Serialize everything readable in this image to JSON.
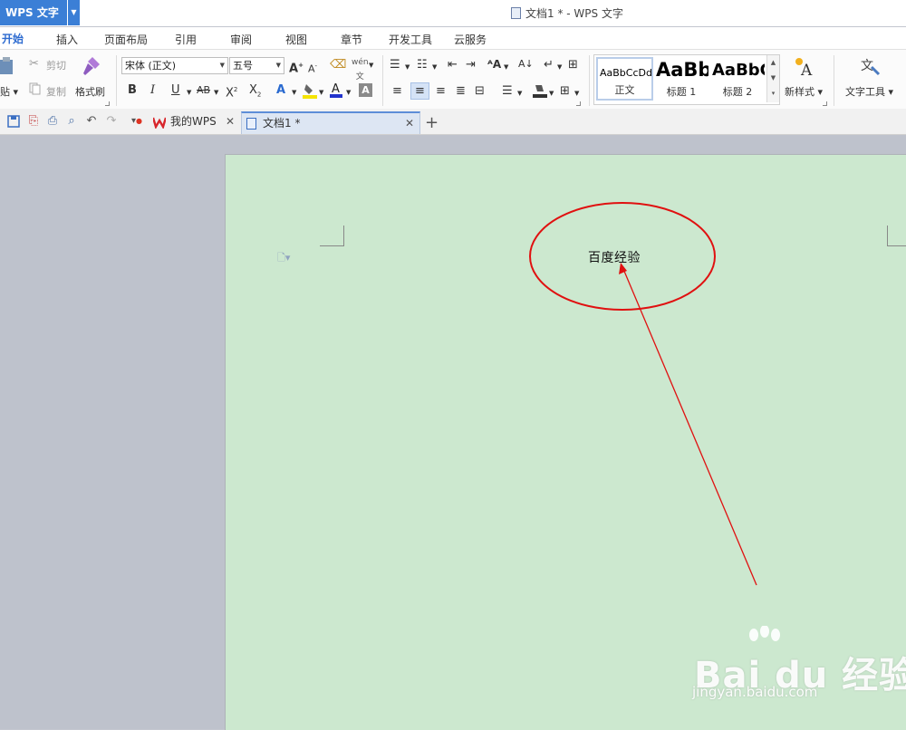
{
  "app": {
    "name": "WPS 文字",
    "window_title": "文档1 * - WPS 文字"
  },
  "menu": {
    "tabs": [
      "开始",
      "插入",
      "页面布局",
      "引用",
      "审阅",
      "视图",
      "章节",
      "开发工具",
      "云服务"
    ]
  },
  "ribbon": {
    "clipboard": {
      "paste": "贴",
      "cut": "剪切",
      "copy": "复制",
      "format_painter": "格式刷"
    },
    "font": {
      "family": "宋体 (正文)",
      "size": "五号"
    },
    "styles": {
      "normal_preview": "AaBbCcDd",
      "normal": "正文",
      "h1_preview": "AaBb",
      "h1": "标题 1",
      "h2_preview": "AaBbC",
      "h2": "标题 2"
    },
    "new_style": "新样式",
    "text_tools": "文字工具"
  },
  "doc_tabs": [
    {
      "label": "我的WPS"
    },
    {
      "label": "文档1 *"
    }
  ],
  "document": {
    "text": "百度经验"
  },
  "colors": {
    "accent": "#3b7fd6",
    "page": "#cce8cf",
    "annotation": "#e01010"
  },
  "watermark": {
    "brand": "Bai du 经验",
    "url": "jingyan.baidu.com"
  }
}
